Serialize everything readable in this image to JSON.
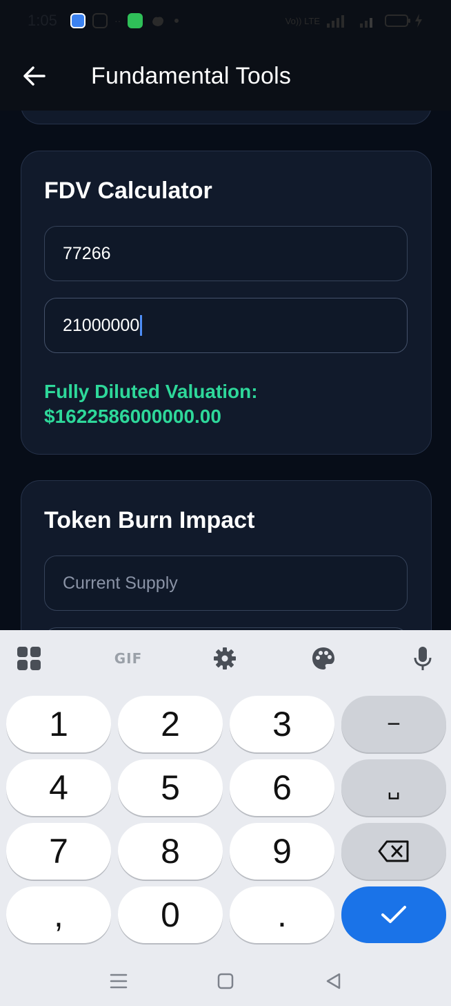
{
  "status_bar": {
    "time": "1:05",
    "dots": "··",
    "network_label": "Vo)) LTE"
  },
  "app_bar": {
    "title": "Fundamental Tools",
    "back_icon": "arrow-left-icon"
  },
  "fdv_card": {
    "title": "FDV Calculator",
    "price_value": "77266",
    "supply_value": "21000000",
    "result_label": "Fully Diluted Valuation:",
    "result_value": "$1622586000000.00"
  },
  "burn_card": {
    "title": "Token Burn Impact",
    "current_supply_placeholder": "Current Supply"
  },
  "keyboard": {
    "toolbar": {
      "grid_icon": "apps-grid-icon",
      "gif_label": "GIF",
      "settings_icon": "gear-icon",
      "theme_icon": "palette-icon",
      "mic_icon": "microphone-icon"
    },
    "rows": [
      [
        "1",
        "2",
        "3",
        "−"
      ],
      [
        "4",
        "5",
        "6",
        "␣"
      ],
      [
        "7",
        "8",
        "9",
        "backspace-icon"
      ],
      [
        ",",
        "0",
        ".",
        "check-icon"
      ]
    ],
    "colors": {
      "accent": "#1a73e8",
      "key_bg": "#ffffff",
      "special_key_bg": "#cfd2d8"
    }
  },
  "nav_bar": {
    "recents_icon": "menu-lines-icon",
    "home_icon": "home-square-icon",
    "back_icon": "back-triangle-icon"
  },
  "colors": {
    "background": "#070d18",
    "card": "#111a2b",
    "result_green": "#2ed89a"
  }
}
